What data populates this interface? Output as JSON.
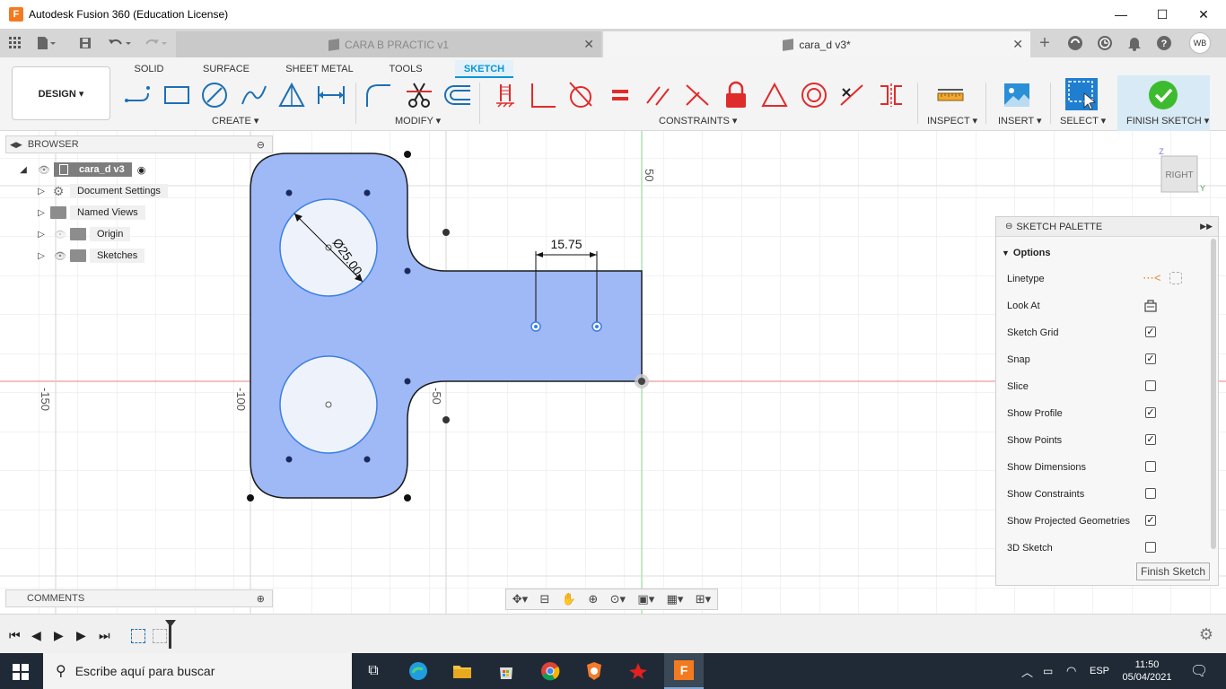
{
  "window": {
    "title": "Autodesk Fusion 360 (Education License)",
    "logo_letter": "F",
    "minimize": "—",
    "maximize": "☐",
    "close": "✕"
  },
  "tabs": [
    {
      "label": "CARA B PRACTIC v1",
      "close": "✕"
    },
    {
      "label": "cara_d v3*",
      "close": "✕"
    }
  ],
  "header": {
    "avatar": "WB",
    "add": "+"
  },
  "toolbar": {
    "design": "DESIGN ▾",
    "workspaces": [
      "SOLID",
      "SURFACE",
      "SHEET METAL",
      "TOOLS",
      "SKETCH"
    ],
    "groups": {
      "create": "CREATE ▾",
      "modify": "MODIFY ▾",
      "constraints": "CONSTRAINTS ▾",
      "inspect": "INSPECT ▾",
      "insert": "INSERT ▾",
      "select": "SELECT ▾",
      "finish": "FINISH SKETCH ▾"
    }
  },
  "browser": {
    "title": "BROWSER",
    "root": "cara_d v3",
    "items": [
      "Document Settings",
      "Named Views",
      "Origin",
      "Sketches"
    ]
  },
  "comments": {
    "title": "COMMENTS"
  },
  "sketch": {
    "dimension_linear": "15.75",
    "dimension_diameter": "Ø25.00",
    "axis_labels": {
      "x_neg150": "-150",
      "x_neg100": "-100",
      "x_neg50": "-50",
      "y_50": "50"
    }
  },
  "viewcube": {
    "face": "RIGHT",
    "z": "Z",
    "y": "Y"
  },
  "palette": {
    "title": "SKETCH PALETTE",
    "section": "Options",
    "rows": [
      {
        "label": "Linetype",
        "kind": "icon"
      },
      {
        "label": "Look At",
        "kind": "icon"
      },
      {
        "label": "Sketch Grid",
        "checked": true
      },
      {
        "label": "Snap",
        "checked": true
      },
      {
        "label": "Slice",
        "checked": false
      },
      {
        "label": "Show Profile",
        "checked": true
      },
      {
        "label": "Show Points",
        "checked": true
      },
      {
        "label": "Show Dimensions",
        "checked": false
      },
      {
        "label": "Show Constraints",
        "checked": false
      },
      {
        "label": "Show Projected Geometries",
        "checked": true
      },
      {
        "label": "3D Sketch",
        "checked": false
      }
    ],
    "finish_button": "Finish Sketch"
  },
  "taskbar": {
    "search_placeholder": "Escribe aquí para buscar",
    "language": "ESP",
    "time": "11:50",
    "date": "05/04/2021"
  },
  "colors": {
    "accent": "#0696d7",
    "profile_fill": "#9fb8f6",
    "hole_fill": "#eef3fb",
    "check_green": "#3dbb2e"
  }
}
